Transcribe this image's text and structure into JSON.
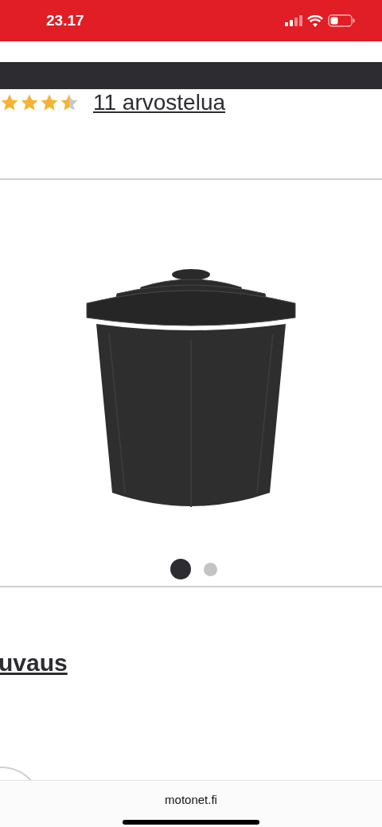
{
  "status_bar": {
    "time": "23.17"
  },
  "rating": {
    "stars": 3.5,
    "reviews_link": "11 arvostelua"
  },
  "gallery": {
    "dots": [
      {
        "selected": true
      },
      {
        "selected": false
      }
    ]
  },
  "section": {
    "heading": "uvaus"
  },
  "browser_bar": {
    "url": "motonet.fi"
  }
}
